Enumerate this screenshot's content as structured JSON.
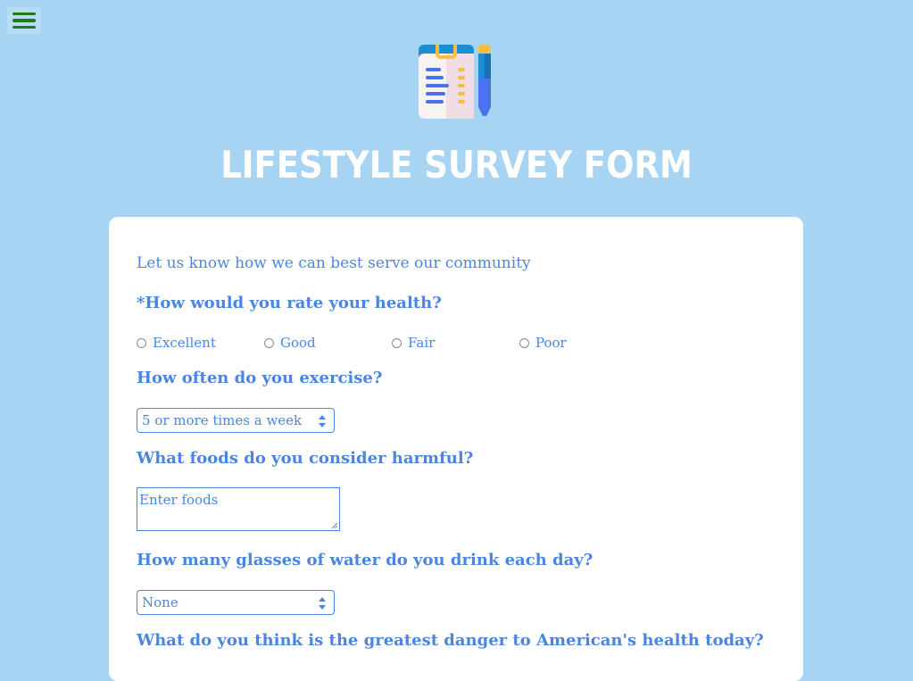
{
  "header": {
    "menu_icon": "hamburger-menu-icon",
    "logo_icon": "survey-clipboard-pen-icon",
    "title": "LIFESTYLE SURVEY FORM"
  },
  "form": {
    "intro": "Let us know how we can best serve our community",
    "q_health": "*How would you rate your health?",
    "health_options": [
      "Excellent",
      "Good",
      "Fair",
      "Poor"
    ],
    "q_exercise": "How often do you exercise?",
    "exercise_value": "5 or more times a week",
    "q_foods": "What foods do you consider harmful?",
    "foods_placeholder": "Enter foods",
    "q_water": "How many glasses of water do you drink each day?",
    "water_value": "None",
    "q_danger": "What do you think is the greatest danger to American's health today?"
  },
  "colors": {
    "background": "#a6d4f2",
    "accent": "#4a86e0",
    "menu": "#1f7a1f"
  }
}
